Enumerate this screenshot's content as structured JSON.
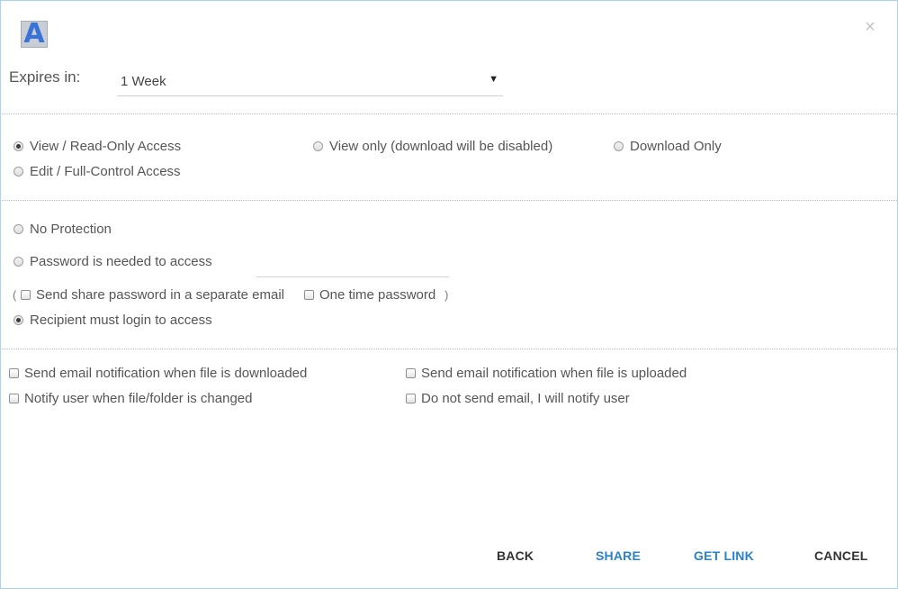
{
  "header": {
    "logo_letter": "A",
    "close_glyph": "×"
  },
  "expires": {
    "label": "Expires in:",
    "selected": "1 Week",
    "arrow": "▼"
  },
  "access": {
    "view_readonly": {
      "label": "View / Read-Only Access",
      "checked": true
    },
    "view_only": {
      "label": "View only (download will be disabled)",
      "checked": false
    },
    "download_only": {
      "label": "Download Only",
      "checked": false
    },
    "edit_full": {
      "label": "Edit / Full-Control Access",
      "checked": false
    }
  },
  "protection": {
    "none": {
      "label": "No Protection",
      "checked": false
    },
    "password": {
      "label": "Password is needed to access",
      "checked": false,
      "value": ""
    },
    "paren_open": "(",
    "paren_close": ")",
    "separate_email": {
      "label": "Send share password in a separate email",
      "checked": false
    },
    "one_time": {
      "label": "One time password",
      "checked": false
    },
    "login": {
      "label": "Recipient must login to access",
      "checked": true
    }
  },
  "notifications": {
    "downloaded": {
      "label": "Send email notification when file is downloaded",
      "checked": false
    },
    "uploaded": {
      "label": "Send email notification when file is uploaded",
      "checked": false
    },
    "changed": {
      "label": "Notify user when file/folder is changed",
      "checked": false
    },
    "no_email": {
      "label": "Do not send email, I will notify user",
      "checked": false
    }
  },
  "buttons": {
    "back": "BACK",
    "share": "SHARE",
    "get_link": "GET LINK",
    "cancel": "CANCEL"
  },
  "colors": {
    "border": "#a9d3ee",
    "accent_blue": "#2a82c8",
    "logo_letter": "#3a73d8"
  }
}
